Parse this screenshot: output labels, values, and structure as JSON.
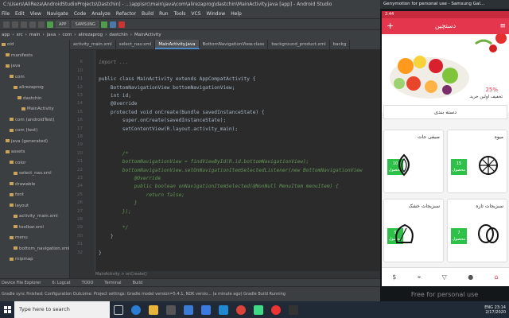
{
  "window_title": "C:\\Users\\AliReza\\AndroidStudioProjects\\Dastchin] - ...\\app\\src\\main\\java\\com\\alirezaprog\\dastchin\\MainActivity.java [app] - Android Studio",
  "menu": [
    "File",
    "Edit",
    "View",
    "Navigate",
    "Code",
    "Analyze",
    "Refactor",
    "Build",
    "Run",
    "Tools",
    "VCS",
    "Window",
    "Help"
  ],
  "toolbar": {
    "config": "APP",
    "device": "SAMSUNG"
  },
  "breadcrumbs": [
    "app",
    "src",
    "main",
    "java",
    "com",
    "alirezaprog",
    "dastchin",
    "MainActivity"
  ],
  "project_tree": [
    {
      "label": "oid",
      "indent": 0
    },
    {
      "label": "manifests",
      "indent": 1
    },
    {
      "label": "java",
      "indent": 1
    },
    {
      "label": "com",
      "indent": 2
    },
    {
      "label": "alirezaprog",
      "indent": 3
    },
    {
      "label": "dastchin",
      "indent": 4
    },
    {
      "label": "MainActivity",
      "indent": 5
    },
    {
      "label": "com (androidTest)",
      "indent": 2
    },
    {
      "label": "com (test)",
      "indent": 2
    },
    {
      "label": "java (generated)",
      "indent": 1
    },
    {
      "label": "assets",
      "indent": 1
    },
    {
      "label": "color",
      "indent": 2
    },
    {
      "label": "select_nav.xml",
      "indent": 3
    },
    {
      "label": "drawable",
      "indent": 2
    },
    {
      "label": "font",
      "indent": 2
    },
    {
      "label": "layout",
      "indent": 2
    },
    {
      "label": "activity_main.xml",
      "indent": 3
    },
    {
      "label": "toolbar.xml",
      "indent": 3
    },
    {
      "label": "menu",
      "indent": 2
    },
    {
      "label": "bottom_navigation.xml",
      "indent": 3
    },
    {
      "label": "mipmap",
      "indent": 2
    }
  ],
  "editor_tabs": [
    {
      "label": "activity_main.xml",
      "active": false
    },
    {
      "label": "select_nav.xml",
      "active": false
    },
    {
      "label": "MainActivity.java",
      "active": true
    },
    {
      "label": "BottomNavigationView.class",
      "active": false
    },
    {
      "label": "background_product.xml",
      "active": false
    },
    {
      "label": "backg",
      "active": false
    }
  ],
  "line_numbers": [
    "6",
    "10",
    "11",
    "12",
    "13",
    "14",
    "15",
    "16",
    "17",
    "18",
    "19",
    "20",
    "21",
    "22",
    "23",
    "24",
    "25",
    "26",
    "27",
    "28",
    "29",
    "30",
    "31",
    "32"
  ],
  "code_lines": [
    "",
    "import ...",
    "",
    "public class MainActivity extends AppCompatActivity {",
    "    BottomNavigationView bottomNavigationView;",
    "    int id;",
    "    @Override",
    "    protected void onCreate(Bundle savedInstanceState) {",
    "        super.onCreate(savedInstanceState);",
    "        setContentView(R.layout.activity_main);",
    "",
    "",
    "        /*",
    "        bottomNavigationView = findViewById(R.id.bottomNavigationView);",
    "        bottomNavigationView.setOnNavigationItemSelectedListener(new BottomNavigationView",
    "            @Override",
    "            public boolean onNavigationItemSelected(@NonNull MenuItem menuItem) {",
    "                return false;",
    "            }",
    "        });",
    "",
    "        */",
    "    }",
    "",
    "}"
  ],
  "editor_breadcrumb": "MainActivity  >  onCreate()",
  "bottom_tabs": [
    "Device File Explorer",
    "6: Logcat",
    "TODO",
    "Terminal",
    "Build"
  ],
  "status_text": "Gradle sync finished: Configuration Outcome: Project settings: Gradle model version=5.4.1, NDK versio... (a minute ago)   Gradle Build Running",
  "taskbar": {
    "search_placeholder": "Type here to search",
    "time": "23:14",
    "date": "2/17/2020",
    "lang": "ENG"
  },
  "emulator": {
    "title": "Genymotion for personal use - Samsung Gal...",
    "status_time": "2:44",
    "app_title": "دستچین",
    "banner_discount": "25%",
    "banner_caption": "تخفیف اولین خرید",
    "category_button": "دسته بندی",
    "cards": [
      {
        "name": "میوه",
        "count": "15",
        "unit": "محصول",
        "icon": "orange-icon"
      },
      {
        "name": "صیفی جات",
        "count": "10",
        "unit": "محصول",
        "icon": "onion-icon"
      },
      {
        "name": "سبزیجات تازه",
        "count": "7",
        "unit": "محصول",
        "icon": "potato-icon"
      },
      {
        "name": "سبزیجات خشک",
        "count": "5",
        "unit": "محصول",
        "icon": "spinach-icon"
      }
    ],
    "nav_icons": [
      "home-icon",
      "user-icon",
      "basket-icon",
      "location-icon",
      "money-icon"
    ],
    "watermark": "Free for personal use"
  },
  "colors": {
    "accent": "#e4374d",
    "badge": "#2ec14a",
    "ide_bg": "#2b2b2b"
  }
}
